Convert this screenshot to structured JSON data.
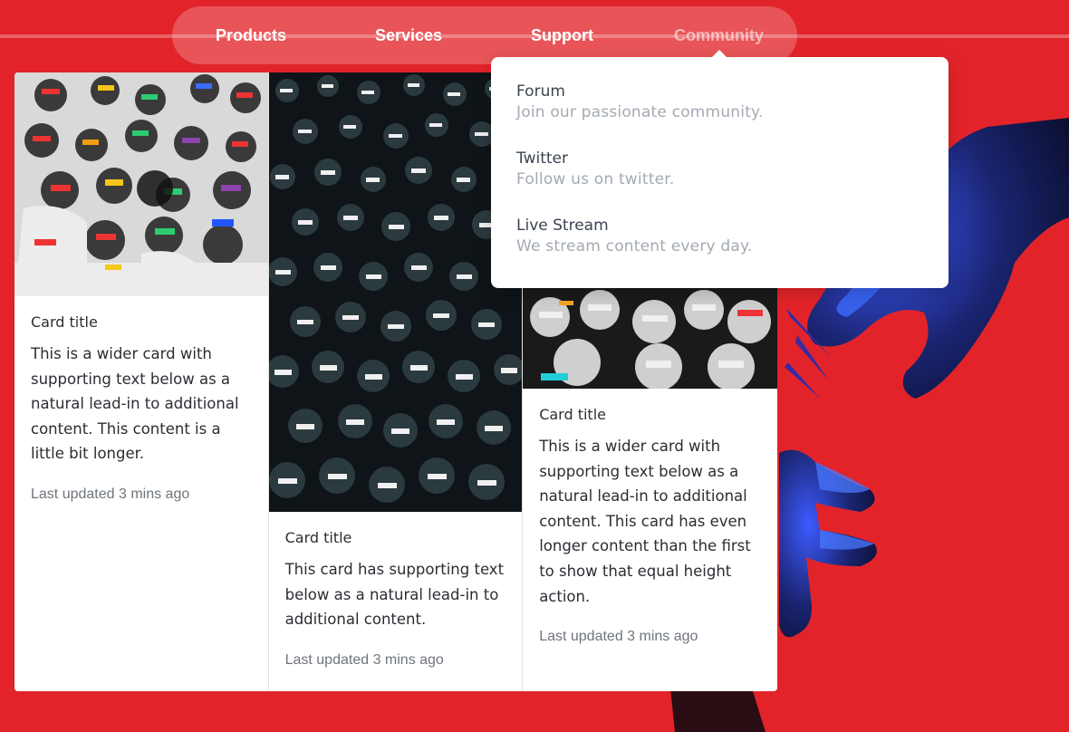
{
  "nav": {
    "items": [
      "Products",
      "Services",
      "Support",
      "Community"
    ],
    "active_index": 3
  },
  "dropdown": {
    "items": [
      {
        "title": "Forum",
        "description": "Join our passionate community."
      },
      {
        "title": "Twitter",
        "description": "Follow us on twitter."
      },
      {
        "title": "Live Stream",
        "description": "We stream content every day."
      }
    ]
  },
  "cards": [
    {
      "title": "Card title",
      "text": "This is a wider card with supporting text below as a natural lead-in to additional content. This content is a little bit longer.",
      "meta": "Last updated 3 mins ago"
    },
    {
      "title": "Card title",
      "text": "This card has supporting text below as a natural lead-in to additional content.",
      "meta": "Last updated 3 mins ago"
    },
    {
      "title": "Card title",
      "text": "This is a wider card with supporting text below as a natural lead-in to additional content. This card has even longer content than the first to show that equal height action.",
      "meta": "Last updated 3 mins ago"
    }
  ],
  "colors": {
    "background": "#e2242a",
    "hands": "#1e2b8c",
    "card_bg": "#ffffff",
    "dropdown_title": "#3b4451",
    "dropdown_desc": "#a3aab3"
  }
}
